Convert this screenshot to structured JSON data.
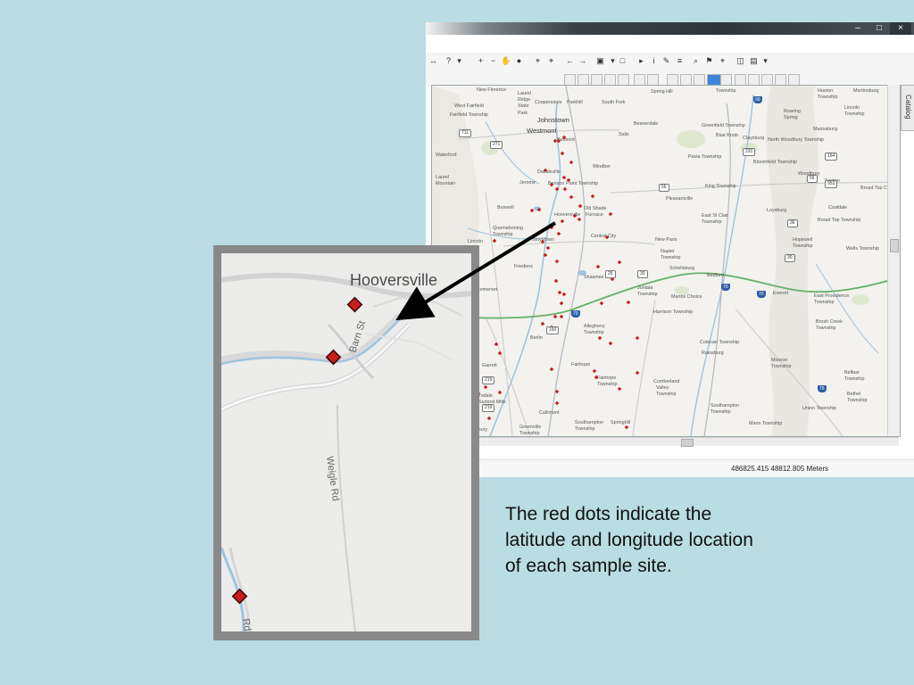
{
  "caption": {
    "lines": [
      "The red dots indicate the",
      "latitude and longitude location",
      "of each sample site."
    ]
  },
  "window": {
    "controls": {
      "minimize": "–",
      "maximize": "□",
      "close": "×"
    },
    "catalog_tab": "Catalog",
    "status_coordinates": "486825.415  48812.805 Meters"
  },
  "toolbar1_icons": [
    "connect-icon",
    "whats-this-icon",
    "dropdown-icon",
    "zoom-in-icon",
    "zoom-out-icon",
    "pan-icon",
    "full-extent-icon",
    "fixed-zoom-in-icon",
    "fixed-zoom-out-icon",
    "back-icon",
    "forward-icon",
    "select-features-icon",
    "dropdown-icon",
    "clear-selection-icon",
    "select-elements-icon",
    "identify-icon",
    "html-popup-icon",
    "measure-icon",
    "find-icon",
    "find-route-icon",
    "goto-xy-icon",
    "time-slider-icon",
    "create-viewer-icon",
    "dropdown-icon"
  ],
  "toolbar2_icons": [
    "editor-icon",
    "edit-vertices-icon",
    "reshape-icon",
    "cut-polygons-icon",
    "split-icon",
    "rotate-icon",
    "attributes-icon",
    "sketch-properties-icon",
    "snapping-icon",
    "topology-icon",
    "color-picker-icon",
    "dropdown-icon",
    "layer-icon",
    "layer-icon",
    "layer-icon",
    "layer-icon",
    "dropdown-icon"
  ],
  "map_labels": [
    {
      "text": "New Florence"
    },
    {
      "text": "Laurel"
    },
    {
      "text": "Ridge"
    },
    {
      "text": "State"
    },
    {
      "text": "Park"
    },
    {
      "text": "Coopersdale"
    },
    {
      "text": "Parkhill"
    },
    {
      "text": "South Fork"
    },
    {
      "text": "Spring Hill"
    },
    {
      "text": "Township"
    },
    {
      "text": "West Fairfield"
    },
    {
      "text": "Fairfield Township"
    },
    {
      "text": "Johnstown"
    },
    {
      "text": "Westmont"
    },
    {
      "text": "Beaverdale"
    },
    {
      "text": "Salix"
    },
    {
      "text": "Greenfield Township"
    },
    {
      "text": "Blue Knob"
    },
    {
      "text": "Claysburg"
    },
    {
      "text": "North Woodbury Township"
    },
    {
      "text": "Huston"
    },
    {
      "text": "Township"
    },
    {
      "text": "Martinsburg"
    },
    {
      "text": "Roaring"
    },
    {
      "text": "Spring"
    },
    {
      "text": "Marinsburg"
    },
    {
      "text": "Lincoln"
    },
    {
      "text": "Township"
    },
    {
      "text": "Belmont"
    },
    {
      "text": "Waterford"
    },
    {
      "text": "Windber"
    },
    {
      "text": "Davidsville"
    },
    {
      "text": "Jerome"
    },
    {
      "text": "Benson"
    },
    {
      "text": "Paint Township"
    },
    {
      "text": "Pavia Township"
    },
    {
      "text": "Bloomfield Township"
    },
    {
      "text": "Woodbury"
    },
    {
      "text": "Laurel"
    },
    {
      "text": "Mountain"
    },
    {
      "text": "King Township"
    },
    {
      "text": "Saxton"
    },
    {
      "text": "Broad Top C"
    },
    {
      "text": "Boswell"
    },
    {
      "text": "Pleasantville"
    },
    {
      "text": "Old Shade"
    },
    {
      "text": "Furnace"
    },
    {
      "text": "Hooversville"
    },
    {
      "text": "Quemahoning"
    },
    {
      "text": "Township"
    },
    {
      "text": "East St Clair"
    },
    {
      "text": "Township"
    },
    {
      "text": "Loysburg"
    },
    {
      "text": "Coaldale"
    },
    {
      "text": "Broad Top Township"
    },
    {
      "text": "Central City"
    },
    {
      "text": "New Paris"
    },
    {
      "text": "Hopewell"
    },
    {
      "text": "Township"
    },
    {
      "text": "Wells Township"
    },
    {
      "text": "Lincoln"
    },
    {
      "text": "Napier"
    },
    {
      "text": "Township"
    },
    {
      "text": "Stoystown"
    },
    {
      "text": "Friedens"
    },
    {
      "text": "Schellsburg"
    },
    {
      "text": "Shawnee Lake"
    },
    {
      "text": "Bedford"
    },
    {
      "text": "Juniata"
    },
    {
      "text": "Township"
    },
    {
      "text": "Manns Choice"
    },
    {
      "text": "Everett"
    },
    {
      "text": "East Providence"
    },
    {
      "text": "Township"
    },
    {
      "text": "Somerset"
    },
    {
      "text": "Harrison Township"
    },
    {
      "text": "Brush Creek"
    },
    {
      "text": "Township"
    },
    {
      "text": "Allegheny"
    },
    {
      "text": "Township"
    },
    {
      "text": "Berlin"
    },
    {
      "text": "Colerain Township"
    },
    {
      "text": "Rainsburg"
    },
    {
      "text": "Monroe"
    },
    {
      "text": "Township"
    },
    {
      "text": "Garrett"
    },
    {
      "text": "Fairhope"
    },
    {
      "text": "Fairhope"
    },
    {
      "text": "Township"
    },
    {
      "text": "Cumberland"
    },
    {
      "text": "Valley"
    },
    {
      "text": "Township"
    },
    {
      "text": "Belfast"
    },
    {
      "text": "Township"
    },
    {
      "text": "Meyersdale"
    },
    {
      "text": "Bethel"
    },
    {
      "text": "Township"
    },
    {
      "text": "Summit Mills"
    },
    {
      "text": "Southampton"
    },
    {
      "text": "Township"
    },
    {
      "text": "Union Township"
    },
    {
      "text": "Callimont"
    },
    {
      "text": "Springhill"
    },
    {
      "text": "Mann Township"
    },
    {
      "text": "Southampton"
    },
    {
      "text": "Township"
    },
    {
      "text": "Greenville"
    },
    {
      "text": "Township"
    },
    {
      "text": "Salisbury"
    }
  ],
  "route_shields": [
    "711",
    "271",
    "56",
    "220",
    "164",
    "953",
    "56",
    "36",
    "30",
    "26",
    "30",
    "219",
    "160",
    "219"
  ],
  "interstate_shields": [
    "99",
    "70",
    "70",
    "70",
    "76"
  ],
  "inset": {
    "town_label": "Hooversville",
    "road_labels": [
      "Barn St",
      "Weigle Rd",
      "Rd"
    ]
  },
  "colors": {
    "background": "#b9dde3",
    "sample_dot": "#c81e1e",
    "map_background": "#f3f2ee",
    "water": "#9ec4e0",
    "turnpike": "#67b26b"
  }
}
